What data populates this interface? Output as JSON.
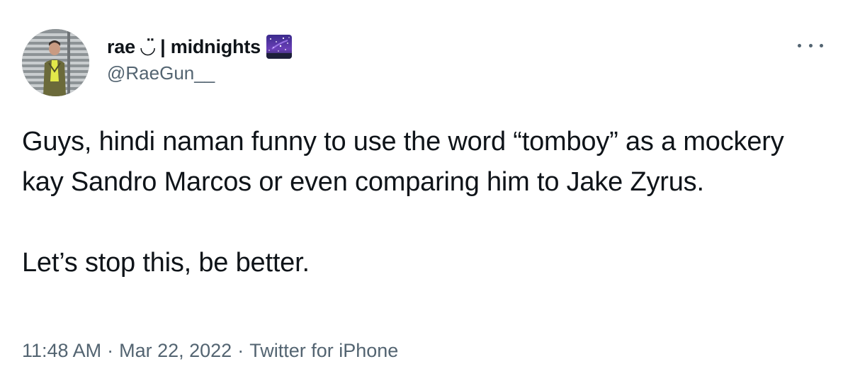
{
  "author": {
    "display_name": "rae ◡̈ | midnights",
    "name_emoji": "night-sky-emoji",
    "handle": "@RaeGun__",
    "avatar": "profile-photo"
  },
  "menu": {
    "icon": "more-options-icon"
  },
  "tweet": {
    "paragraphs": [
      "Guys, hindi naman funny to use the word “tomboy” as a mockery kay Sandro Marcos or even comparing him to Jake Zyrus.",
      "Let’s stop this, be better."
    ]
  },
  "meta": {
    "time": "11:48 AM",
    "separator": "·",
    "date": "Mar 22, 2022",
    "source": "Twitter for iPhone"
  },
  "colors": {
    "text": "#0f1419",
    "secondary": "#536471",
    "background": "#ffffff"
  }
}
